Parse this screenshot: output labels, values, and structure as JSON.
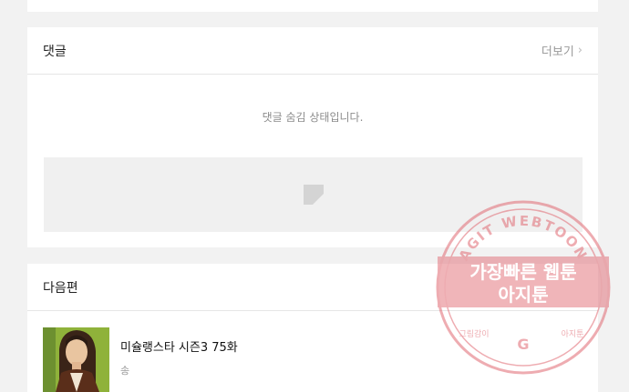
{
  "comments": {
    "title": "댓글",
    "more_label": "더보기",
    "more_chevron": "›",
    "hidden_message": "댓글 숨김 상태입니다."
  },
  "next_episode": {
    "title": "다음편",
    "episode_title": "미슐랭스타 시즌3 75화",
    "author": "송"
  },
  "watermark": {
    "top_text": "AGIT WEBTOON",
    "line1": "가장빠른 웹툰",
    "line2": "아지툰",
    "bottom_left": "그림감이",
    "bottom_right": "아지툰",
    "color": "#e16a73"
  }
}
